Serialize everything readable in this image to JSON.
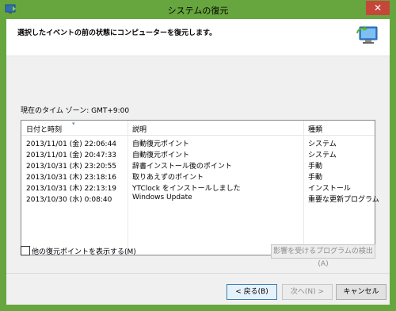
{
  "window": {
    "title": "システムの復元",
    "close_label": "✕"
  },
  "header": {
    "instruction": "選択したイベントの前の状態にコンピューターを復元します。"
  },
  "timezone": "現在のタイム ゾーン: GMT+9:00",
  "table": {
    "headers": [
      "日付と時刻",
      "説明",
      "種類"
    ],
    "rows": [
      [
        "2013/11/01 (金) 22:06:44",
        "自動復元ポイント",
        "システム"
      ],
      [
        "2013/11/01 (金) 20:47:33",
        "自動復元ポイント",
        "システム"
      ],
      [
        "2013/10/31 (木) 23:20:55",
        "辞書インストール後のポイント",
        "手動"
      ],
      [
        "2013/10/31 (木) 23:18:16",
        "取りあえずのポイント",
        "手動"
      ],
      [
        "2013/10/31 (木) 22:13:19",
        "YTClock をインストールしました",
        "インストール"
      ],
      [
        "2013/10/30 (水) 0:08:40",
        "Windows Update",
        "重要な更新プログラム"
      ]
    ]
  },
  "show_more_label": "他の復元ポイントを表示する(M)",
  "scan_button": "影響を受けるプログラムの検出(A)",
  "buttons": {
    "back": "< 戻る(B)",
    "next": "次へ(N) >",
    "cancel": "キャンセル"
  },
  "colors": {
    "title_bar": "#67a63e",
    "close": "#c7463a"
  }
}
